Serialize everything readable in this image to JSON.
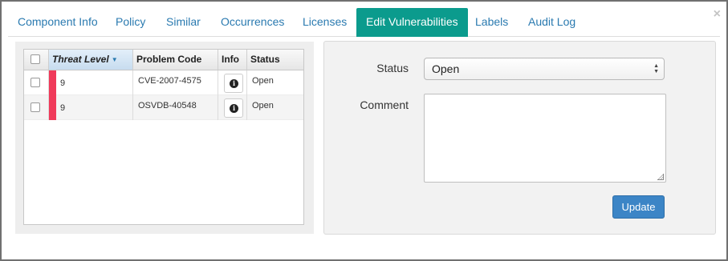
{
  "dialog": {
    "close_glyph": "×"
  },
  "tabs": [
    {
      "label": "Component Info",
      "active": false
    },
    {
      "label": "Policy",
      "active": false
    },
    {
      "label": "Similar",
      "active": false
    },
    {
      "label": "Occurrences",
      "active": false
    },
    {
      "label": "Licenses",
      "active": false
    },
    {
      "label": "Edit Vulnerabilities",
      "active": true
    },
    {
      "label": "Labels",
      "active": false
    },
    {
      "label": "Audit Log",
      "active": false
    }
  ],
  "grid": {
    "columns": {
      "threat_level": "Threat Level",
      "problem_code": "Problem Code",
      "info": "Info",
      "status": "Status"
    },
    "sort_indicator": "▼",
    "rows": [
      {
        "threat": "9",
        "threat_color": "#f03a5a",
        "code": "CVE-2007-4575",
        "info_icon": "info-icon",
        "status": "Open"
      },
      {
        "threat": "9",
        "threat_color": "#f03a5a",
        "code": "OSVDB-40548",
        "info_icon": "info-icon",
        "status": "Open"
      }
    ]
  },
  "form": {
    "status_label": "Status",
    "status_value": "Open",
    "comment_label": "Comment",
    "comment_value": "",
    "update_label": "Update"
  },
  "colors": {
    "accent_tab": "#0b9b8d",
    "link": "#2a7ab0",
    "threat_high": "#f03a5a",
    "primary_button": "#3c85c6"
  }
}
